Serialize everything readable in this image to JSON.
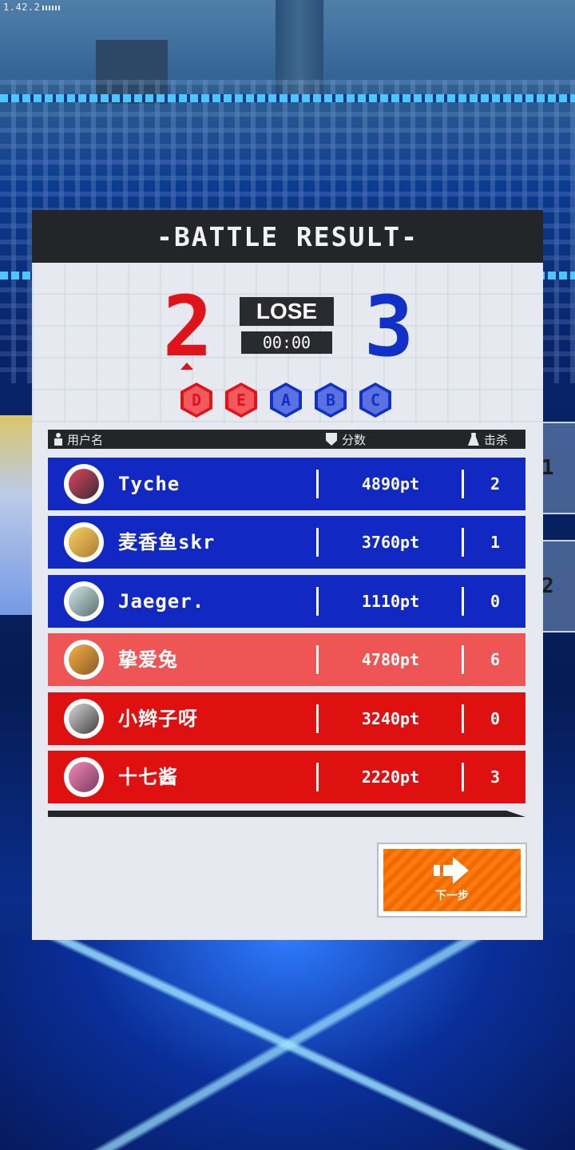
{
  "app": {
    "version": "1.42.2"
  },
  "panel": {
    "title": "-BATTLE RESULT-"
  },
  "score": {
    "red_team": "2",
    "blue_team": "3",
    "result": "LOSE",
    "timer": "00:00",
    "red_color": "#e0121a",
    "blue_color": "#1030c8"
  },
  "ranks": [
    {
      "label": "D",
      "team": "red"
    },
    {
      "label": "E",
      "team": "red"
    },
    {
      "label": "A",
      "team": "blue"
    },
    {
      "label": "B",
      "team": "blue"
    },
    {
      "label": "C",
      "team": "blue"
    }
  ],
  "columns": {
    "username": "用户名",
    "score": "分数",
    "kills": "击杀"
  },
  "players": [
    {
      "name": "Tyche",
      "score": "4890pt",
      "kills": "2",
      "team": "blue"
    },
    {
      "name": "麦香鱼skr",
      "score": "3760pt",
      "kills": "1",
      "team": "blue"
    },
    {
      "name": "Jaeger.",
      "score": "1110pt",
      "kills": "0",
      "team": "blue"
    },
    {
      "name": "挚爱兔",
      "score": "4780pt",
      "kills": "6",
      "team": "red"
    },
    {
      "name": "小辫子呀",
      "score": "3240pt",
      "kills": "0",
      "team": "red"
    },
    {
      "name": "十七酱",
      "score": "2220pt",
      "kills": "3",
      "team": "red"
    }
  ],
  "side_tabs": [
    "1",
    "2"
  ],
  "next_button": {
    "label": "下一步",
    "color": "#ff7a10"
  }
}
